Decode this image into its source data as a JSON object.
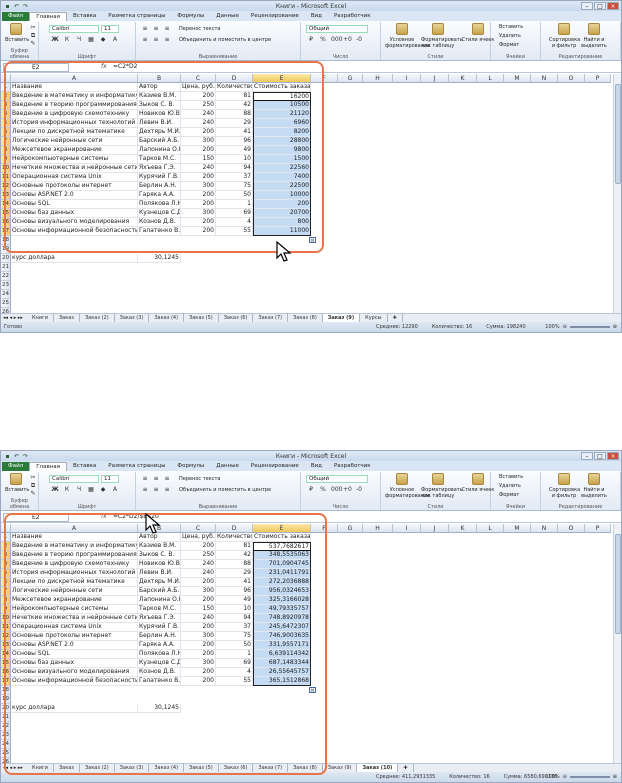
{
  "window_title": "Книги - Microsoft Excel",
  "tabs": [
    "Файл",
    "Главная",
    "Вставка",
    "Разметка страницы",
    "Формулы",
    "Данные",
    "Рецензирование",
    "Вид",
    "Разработчик"
  ],
  "ribbon": {
    "paste": "Вставить",
    "clipboard": "Буфер обмена",
    "font_name": "Calibri",
    "font_size": "11",
    "font_group": "Шрифт",
    "wrap": "Перенос текста",
    "merge": "Объединить и поместить в центре",
    "align_group": "Выравнивание",
    "num_format": "Общий",
    "num_group": "Число",
    "cond": "Условное форматирование",
    "as_table": "Форматировать как таблицу",
    "cell_styles": "Стили ячеек",
    "styles_group": "Стили",
    "insert": "Вставить",
    "delete": "Удалить",
    "format": "Формат",
    "cells_group": "Ячейки",
    "sort": "Сортировка и фильтр",
    "find": "Найти и выделить",
    "edit_group": "Редактирование"
  },
  "columns": [
    "A",
    "B",
    "C",
    "D",
    "E",
    "F",
    "G",
    "H",
    "I",
    "J",
    "K",
    "L",
    "M",
    "N",
    "O",
    "P"
  ],
  "header_row": [
    "Название",
    "Автор",
    "Цена, руб.",
    "Количество",
    "Стоимость заказа"
  ],
  "books": [
    [
      "Введение в математику и информатику",
      "Казиев В.М.",
      "200",
      "81"
    ],
    [
      "Введение в теорию программирования",
      "Зыков С. В.",
      "250",
      "42"
    ],
    [
      "Введение в цифровую схемотехнику",
      "Новиков Ю.В.",
      "240",
      "88"
    ],
    [
      "История информационных технологий",
      "Левин В.И.",
      "240",
      "29"
    ],
    [
      "Лекции по дискретной математике",
      "Дехтярь М.И.",
      "200",
      "41"
    ],
    [
      "Логические нейронные сети",
      "Барский А.Б.",
      "300",
      "96"
    ],
    [
      "Межсетевое экранирование",
      "Лапонина О.Р.",
      "200",
      "49"
    ],
    [
      "Нейрокомпьютерные системы",
      "Тарков М.С.",
      "150",
      "10"
    ],
    [
      "Нечеткие множества и нейронные сети",
      "Яхъева Г.Э.",
      "240",
      "94"
    ],
    [
      "Операционная система Unix",
      "Курячий Г.В.",
      "200",
      "37"
    ],
    [
      "Основные протоколы интернет",
      "Берлин А.Н.",
      "300",
      "75"
    ],
    [
      "Основы ASP.NET 2.0",
      "Гаряка А.А.",
      "200",
      "50"
    ],
    [
      "Основы SQL",
      "Полякова Л.Н.",
      "200",
      "1"
    ],
    [
      "Основы баз данных",
      "Кузнецов С.Д.",
      "300",
      "69"
    ],
    [
      "Основы визуального моделирования",
      "Кознов Д.В.",
      "200",
      "4"
    ],
    [
      "Основы информационной безопасности",
      "Галатенко В.А.",
      "200",
      "55"
    ]
  ],
  "rate_label": "курс доллара",
  "rate_value": "30,1245",
  "shot1": {
    "namebox": "E2",
    "formula": "=C2*D2",
    "values": [
      "16200",
      "10500",
      "21120",
      "6960",
      "8200",
      "28800",
      "9800",
      "1500",
      "22560",
      "7400",
      "22500",
      "10000",
      "200",
      "20700",
      "800",
      "11000"
    ],
    "sheets": [
      "Книги",
      "Заказ",
      "Заказ (2)",
      "Заказ (3)",
      "Заказ (4)",
      "Заказ (5)",
      "Заказ (6)",
      "Заказ (7)",
      "Заказ (8)",
      "Заказ (9)",
      "Курсы"
    ],
    "active_sheet": "Заказ (9)",
    "status_left": "Готово",
    "avg": "Среднее: 12290",
    "count": "Количество: 16",
    "sum": "Сумма: 198240",
    "zoom": "100%"
  },
  "shot2": {
    "namebox": "E2",
    "formula": "=C2*D2/$B$20",
    "values": [
      "537,7682617",
      "348,5535063",
      "701,0904745",
      "231,0411791",
      "272,2036888",
      "956,0324653",
      "325,3166028",
      "49,79335757",
      "748,8920978",
      "245,6472307",
      "746,9003635",
      "331,9557171",
      "6,639114342",
      "687,1483344",
      "26,55645757",
      "365,1512868"
    ],
    "sheets": [
      "Книги",
      "Заказ",
      "Заказ (2)",
      "Заказ (3)",
      "Заказ (4)",
      "Заказ (5)",
      "Заказ (6)",
      "Заказ (7)",
      "Заказ (8)",
      "Заказ (9)",
      "Заказ (10)"
    ],
    "active_sheet": "Заказ (10)",
    "avg": "Среднее: 411,2931335",
    "count": "Количество: 16",
    "sum": "Сумма: 6580,690136",
    "zoom": "100%"
  }
}
